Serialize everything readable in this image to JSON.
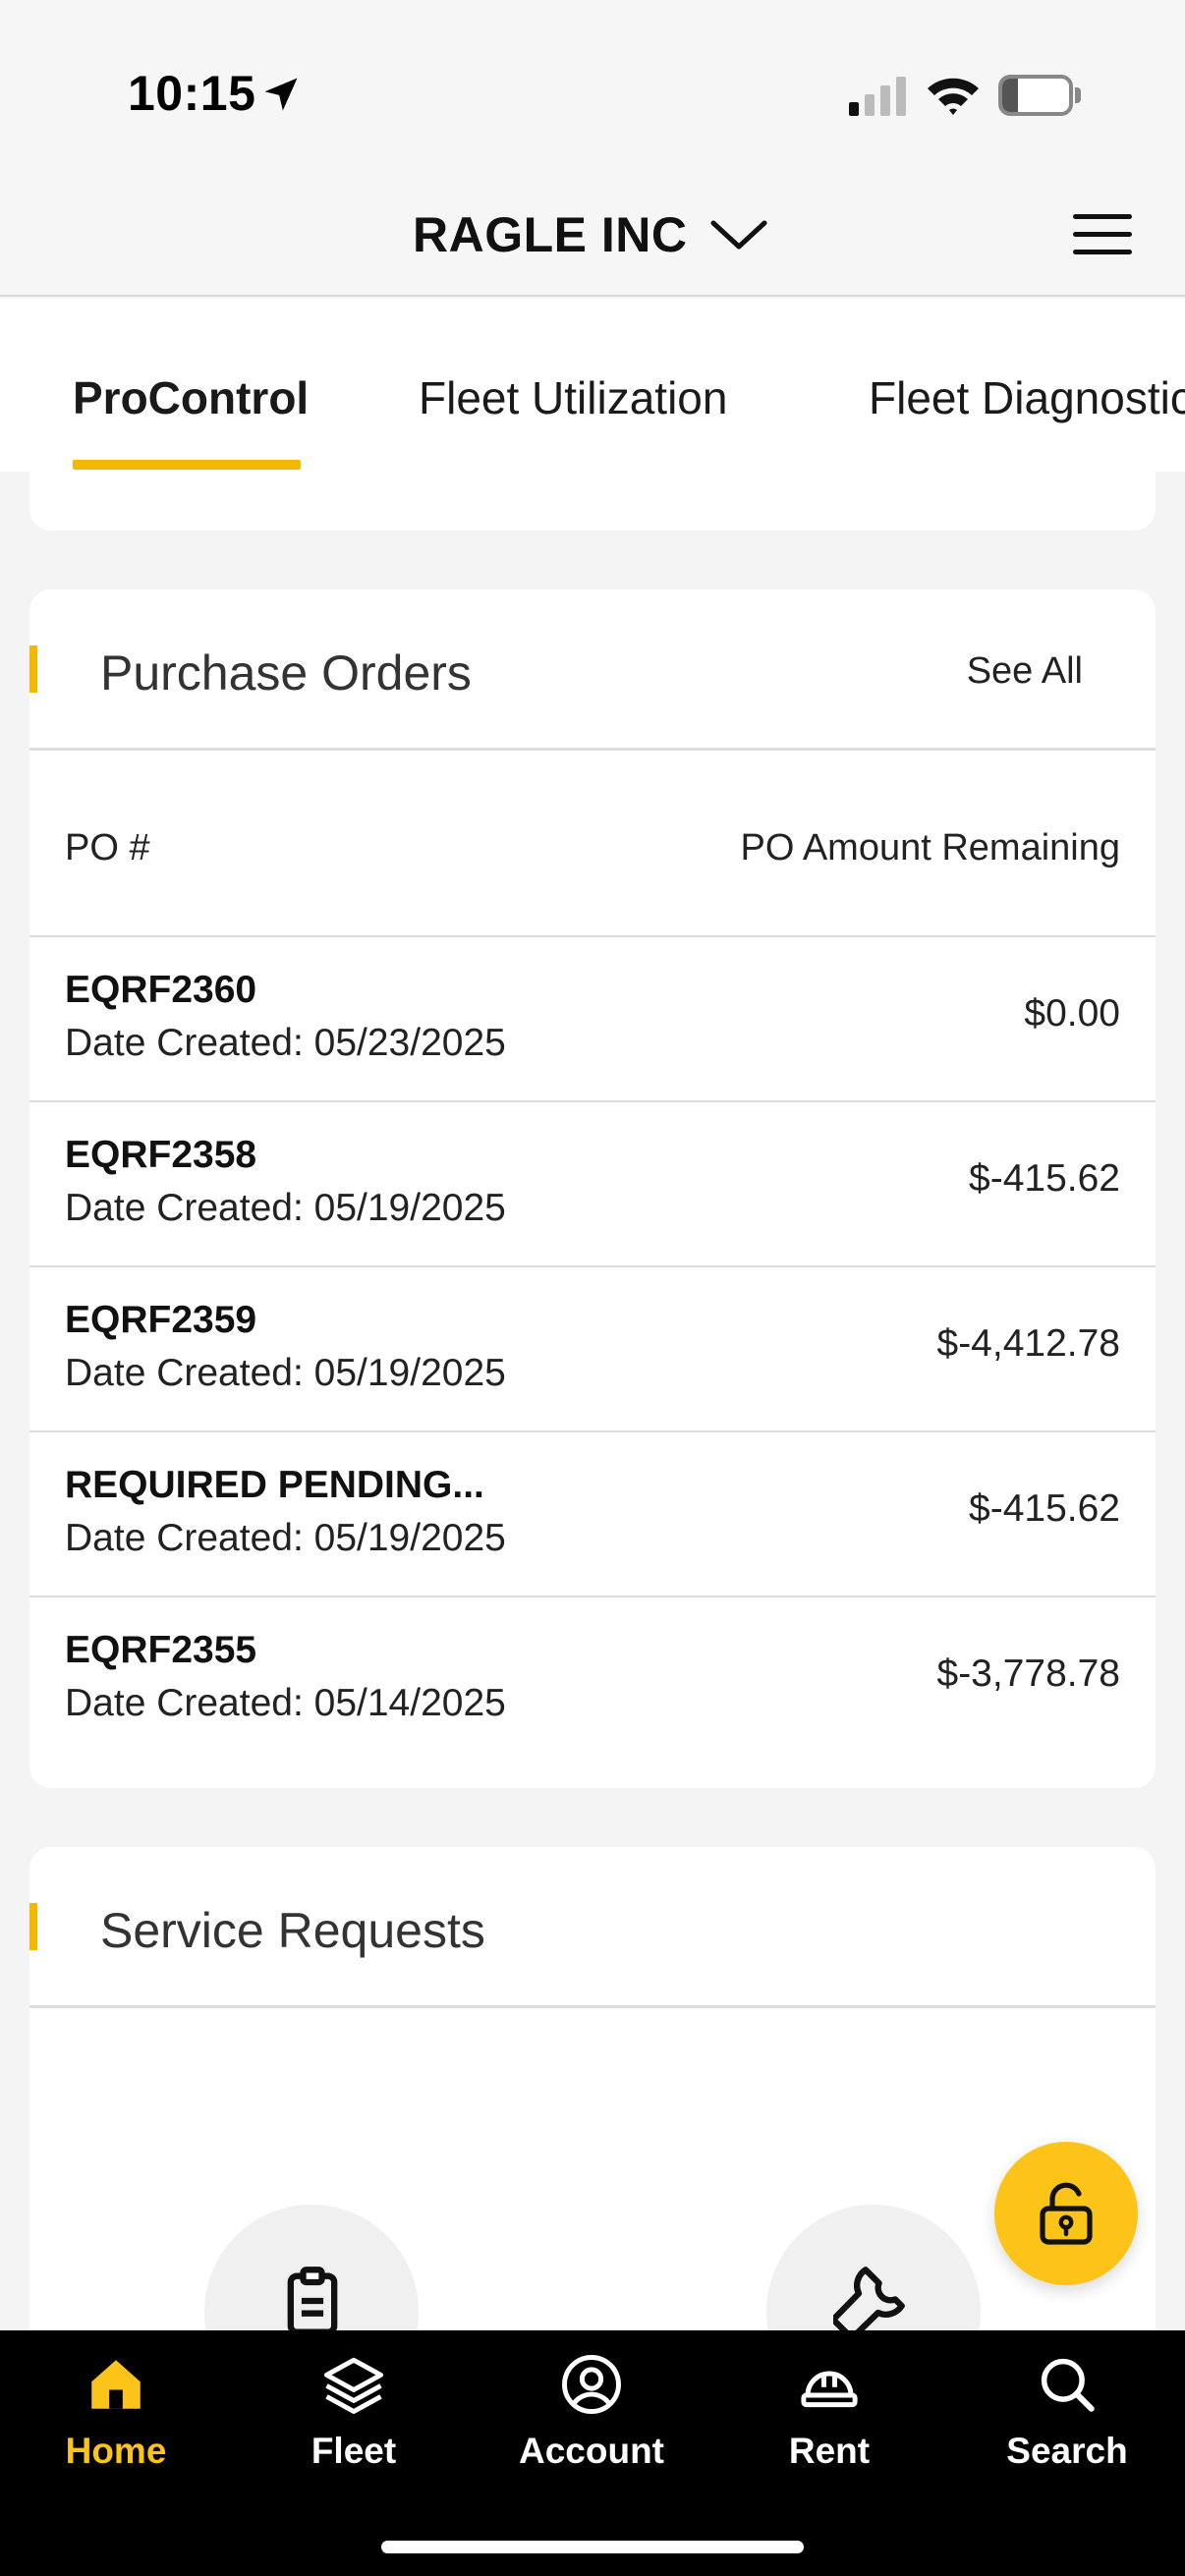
{
  "status_bar": {
    "time": "10:15",
    "battery": "23",
    "battery_level": 0.23
  },
  "header": {
    "company": "RAGLE INC"
  },
  "tabs": [
    {
      "label": "ProControl",
      "active": true
    },
    {
      "label": "Fleet Utilization",
      "active": false
    },
    {
      "label": "Fleet Diagnostics",
      "active": false
    }
  ],
  "purchase_orders": {
    "title": "Purchase Orders",
    "see_all": "See All",
    "col_po": "PO #",
    "col_amount": "PO Amount Remaining",
    "rows": [
      {
        "id": "EQRF2360",
        "date": "Date Created: 05/23/2025",
        "amount": "$0.00"
      },
      {
        "id": "EQRF2358",
        "date": "Date Created: 05/19/2025",
        "amount": "$-415.62"
      },
      {
        "id": "EQRF2359",
        "date": "Date Created: 05/19/2025",
        "amount": "$-4,412.78"
      },
      {
        "id": "REQUIRED PENDING...",
        "date": "Date Created: 05/19/2025",
        "amount": "$-415.62"
      },
      {
        "id": "EQRF2355",
        "date": "Date Created: 05/14/2025",
        "amount": "$-3,778.78"
      }
    ]
  },
  "service_requests": {
    "title": "Service Requests"
  },
  "fab": {
    "icon": "unlock-icon"
  },
  "bottom_nav": [
    {
      "label": "Home",
      "icon": "home-icon",
      "active": true
    },
    {
      "label": "Fleet",
      "icon": "layers-icon",
      "active": false
    },
    {
      "label": "Account",
      "icon": "account-icon",
      "active": false
    },
    {
      "label": "Rent",
      "icon": "hardhat-icon",
      "active": false
    },
    {
      "label": "Search",
      "icon": "search-icon",
      "active": false
    }
  ],
  "colors": {
    "accent": "#fcc419",
    "nav_bg": "#000000",
    "page_bg": "#f4f4f5"
  }
}
